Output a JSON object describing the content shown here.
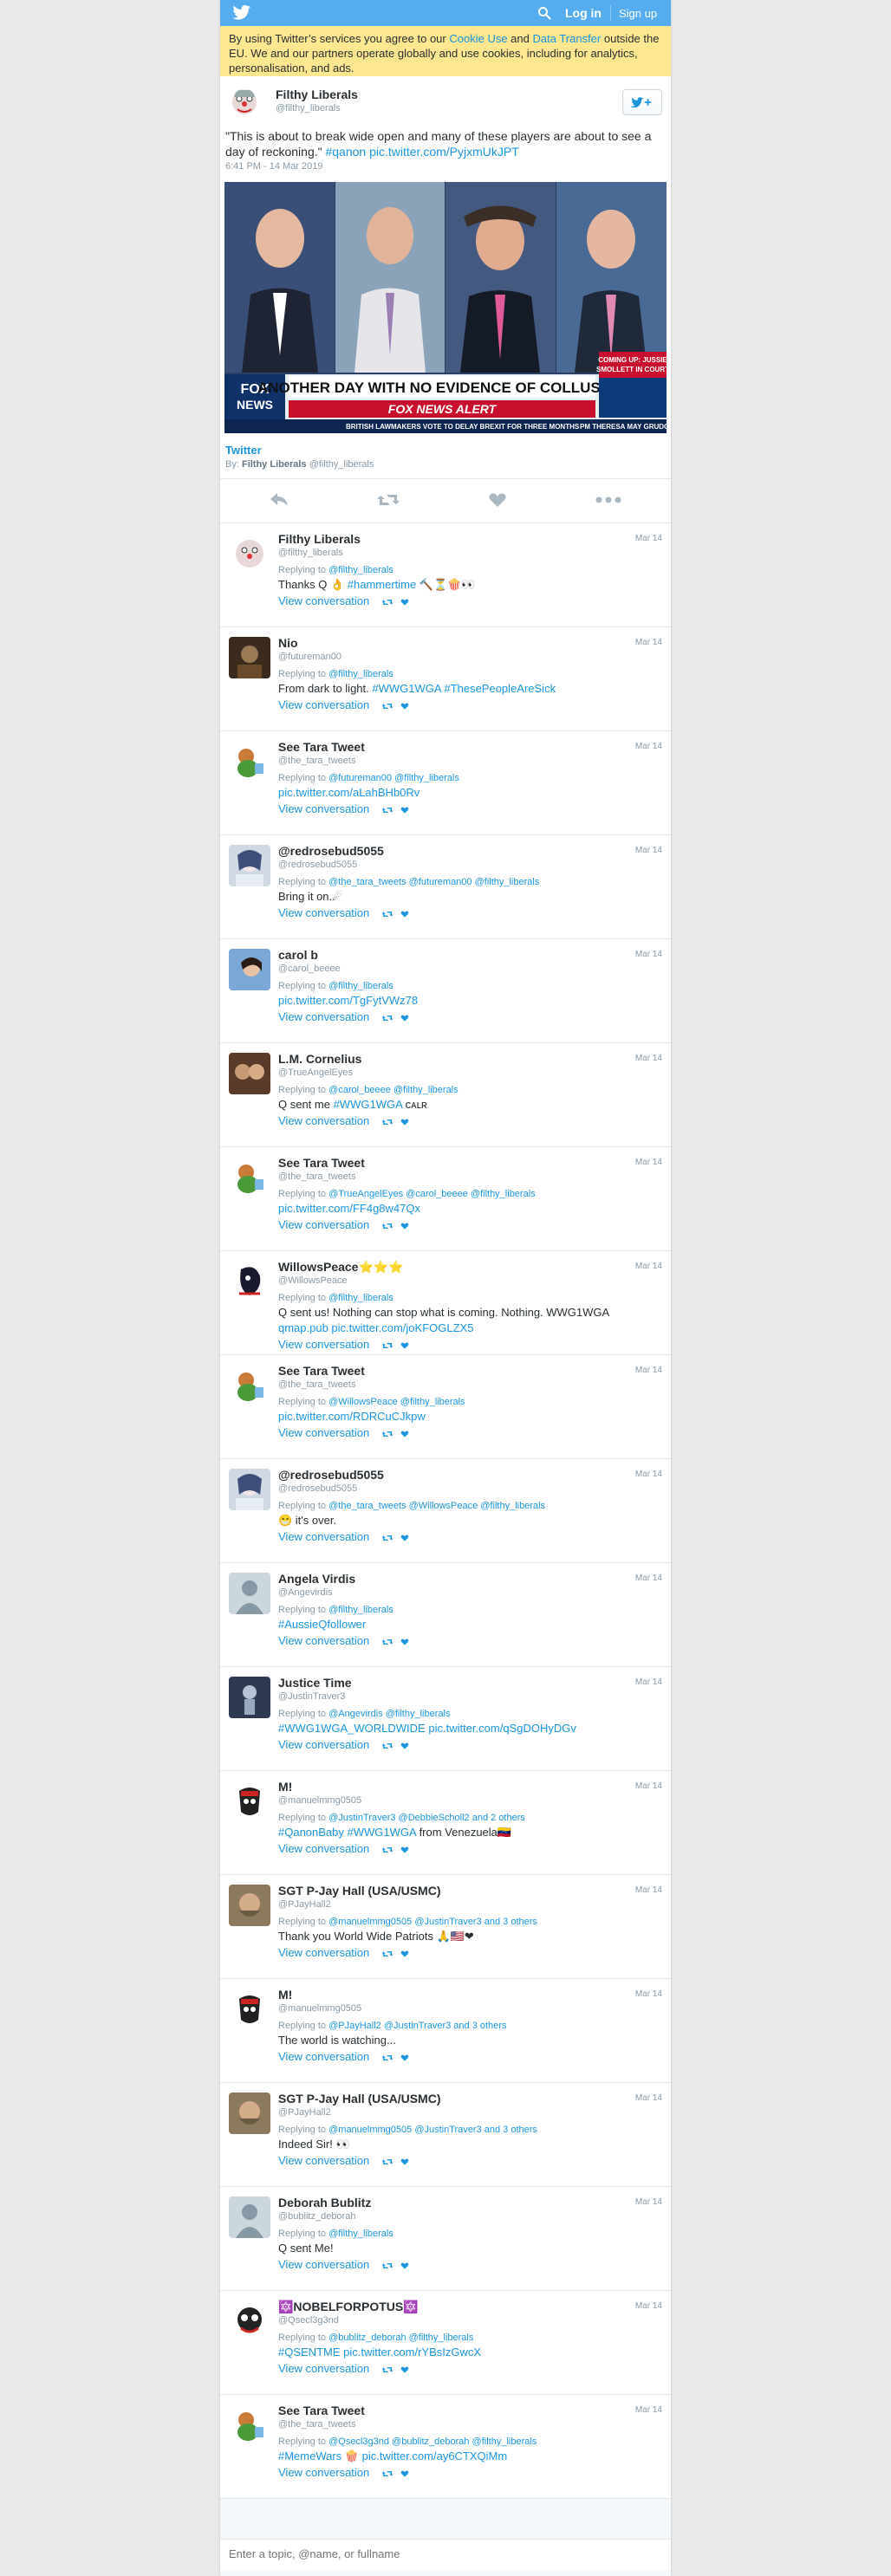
{
  "topbar": {
    "login": "Log in",
    "signup": "Sign up"
  },
  "cookie": {
    "pre": "By using Twitter’s services you agree to our ",
    "cookie_use": "Cookie Use",
    "and": " and ",
    "data_transfer": "Data Transfer",
    "post": " outside the EU. We and our partners operate globally and use cookies, including for analytics, personalisation, and ads."
  },
  "main_tweet": {
    "name": "Filthy Liberals",
    "handle": "@filthy_liberals",
    "text": "\"This is about to break wide open and many of these players are about to see a day of reckoning.\" ",
    "hashtag": "#qanon",
    "link": "pic.twitter.com/PyjxmUkJPT",
    "time": "6:41 PM - 14 Mar 2019",
    "media_banner": "ANOTHER DAY WITH NO EVIDENCE OF COLLUSION",
    "media_alert": "FOX NEWS ALERT",
    "media_ticker": "BRITISH LAWMAKERS VOTE TO DELAY BREXIT FOR THREE MONTHS",
    "media_ticker2": "PM THERESA MAY GRUDGINGLY",
    "media_coming": "COMING UP: JUSSIE SMOLLETT IN COURT",
    "media_source": "Twitter",
    "by_label": "By:",
    "by_name": "Filthy Liberals",
    "by_handle": "@filthy_liberals"
  },
  "view_conversation": "View conversation",
  "replying_to": "Replying to",
  "replies": [
    {
      "name": "Filthy Liberals",
      "handle": "@filthy_liberals",
      "date": "Mar 14",
      "to": "@filthy_liberals",
      "text": "Thanks Q 👌 ",
      "tag": "#hammertime",
      "text2": " 🔨⏳🍿👀",
      "link": ""
    },
    {
      "name": "Nio",
      "handle": "@futureman00",
      "date": "Mar 14",
      "to": "@filthy_liberals",
      "text": "From dark to light. ",
      "tag": "#WWG1WGA #ThesePeopleAreSick",
      "text2": "",
      "link": ""
    },
    {
      "name": "See Tara Tweet",
      "handle": "@the_tara_tweets",
      "date": "Mar 14",
      "to": "@futureman00 @filthy_liberals",
      "text": "",
      "tag": "",
      "text2": "",
      "link": "pic.twitter.com/aLahBHb0Rv"
    },
    {
      "name": "@redrosebud5055",
      "handle": "@redrosebud5055",
      "date": "Mar 14",
      "to": "@the_tara_tweets @futureman00 @filthy_liberals",
      "text": "Bring it on.☄",
      "tag": "",
      "text2": "",
      "link": ""
    },
    {
      "name": "carol b",
      "handle": "@carol_beeee",
      "date": "Mar 14",
      "to": "@filthy_liberals",
      "text": "",
      "tag": "",
      "text2": "",
      "link": "pic.twitter.com/TgFytVWz78"
    },
    {
      "name": "L.M. Cornelius",
      "handle": "@TrueAngelEyes",
      "date": "Mar 14",
      "to": "@carol_beeee @filthy_liberals",
      "text": "Q sent me ",
      "tag": "#WWG1WGA",
      "text2": " ᴄᴀʟʀ",
      "link": ""
    },
    {
      "name": "See Tara Tweet",
      "handle": "@the_tara_tweets",
      "date": "Mar 14",
      "to": "@TrueAngelEyes @carol_beeee @filthy_liberals",
      "text": "",
      "tag": "",
      "text2": "",
      "link": "pic.twitter.com/FF4g8w47Qx"
    },
    {
      "name": "WillowsPeace⭐⭐⭐",
      "handle": "@WillowsPeace",
      "date": "Mar 14",
      "to": "@filthy_liberals",
      "text": "Q sent us! Nothing can stop what is coming. Nothing. WWG1WGA",
      "tag": "",
      "text2": "",
      "link": "qmap.pub pic.twitter.com/joKFOGLZX5"
    },
    {
      "name": "See Tara Tweet",
      "handle": "@the_tara_tweets",
      "date": "Mar 14",
      "to": "@WillowsPeace @filthy_liberals",
      "text": "",
      "tag": "",
      "text2": "",
      "link": "pic.twitter.com/RDRCuCJkpw"
    },
    {
      "name": "@redrosebud5055",
      "handle": "@redrosebud5055",
      "date": "Mar 14",
      "to": "@the_tara_tweets @WillowsPeace @filthy_liberals",
      "text": "😁 it's over.",
      "tag": "",
      "text2": "",
      "link": ""
    },
    {
      "name": "Angela Virdis",
      "handle": "@Angevirdis",
      "date": "Mar 14",
      "to": "@filthy_liberals",
      "text": "",
      "tag": "#AussieQfollower",
      "text2": "",
      "link": ""
    },
    {
      "name": "Justice Time",
      "handle": "@JustinTraver3",
      "date": "Mar 14",
      "to": "@Angevirdis @filthy_liberals",
      "text": "",
      "tag": "#WWG1WGA_WORLDWIDE",
      "text2": "",
      "link": "pic.twitter.com/qSgDOHyDGv"
    },
    {
      "name": "M!",
      "handle": "@manuelmmg0505",
      "date": "Mar 14",
      "to": "@JustinTraver3 @DebbieScholl2 and 2 others",
      "text": "",
      "tag": "#QanonBaby #WWG1WGA",
      "text2": " from Venezuela🇻🇪",
      "link": ""
    },
    {
      "name": "SGT P-Jay Hall (USA/USMC)",
      "handle": "@PJayHall2",
      "date": "Mar 14",
      "to": "@manuelmmg0505 @JustinTraver3 and 3 others",
      "text": "Thank you World Wide Patriots 🙏🇺🇸❤",
      "tag": "",
      "text2": "",
      "link": ""
    },
    {
      "name": "M!",
      "handle": "@manuelmmg0505",
      "date": "Mar 14",
      "to": "@PJayHall2 @JustinTraver3 and 3 others",
      "text": "The world is watching...",
      "tag": "",
      "text2": "",
      "link": ""
    },
    {
      "name": "SGT P-Jay Hall (USA/USMC)",
      "handle": "@PJayHall2",
      "date": "Mar 14",
      "to": "@manuelmmg0505 @JustinTraver3 and 3 others",
      "text": "Indeed Sir! 👀",
      "tag": "",
      "text2": "",
      "link": ""
    },
    {
      "name": "Deborah Bublitz",
      "handle": "@bublitz_deborah",
      "date": "Mar 14",
      "to": "@filthy_liberals",
      "text": "Q sent Me!",
      "tag": "",
      "text2": "",
      "link": ""
    },
    {
      "name": "🔯NOBELFORPOTUS🔯",
      "handle": "@Qsecl3g3nd",
      "date": "Mar 14",
      "to": "@bublitz_deborah @filthy_liberals",
      "text": "",
      "tag": "#QSENTME",
      "text2": "",
      "link": "pic.twitter.com/rYBsIzGwcX"
    },
    {
      "name": "See Tara Tweet",
      "handle": "@the_tara_tweets",
      "date": "Mar 14",
      "to": "@Qsecl3g3nd @bublitz_deborah @filthy_liberals",
      "text": "",
      "tag": "#MemeWars",
      "text2": " 🍿 ",
      "link": "pic.twitter.com/ay6CTXQiMm"
    }
  ],
  "search": {
    "placeholder": "Enter a topic, @name, or fullname"
  }
}
